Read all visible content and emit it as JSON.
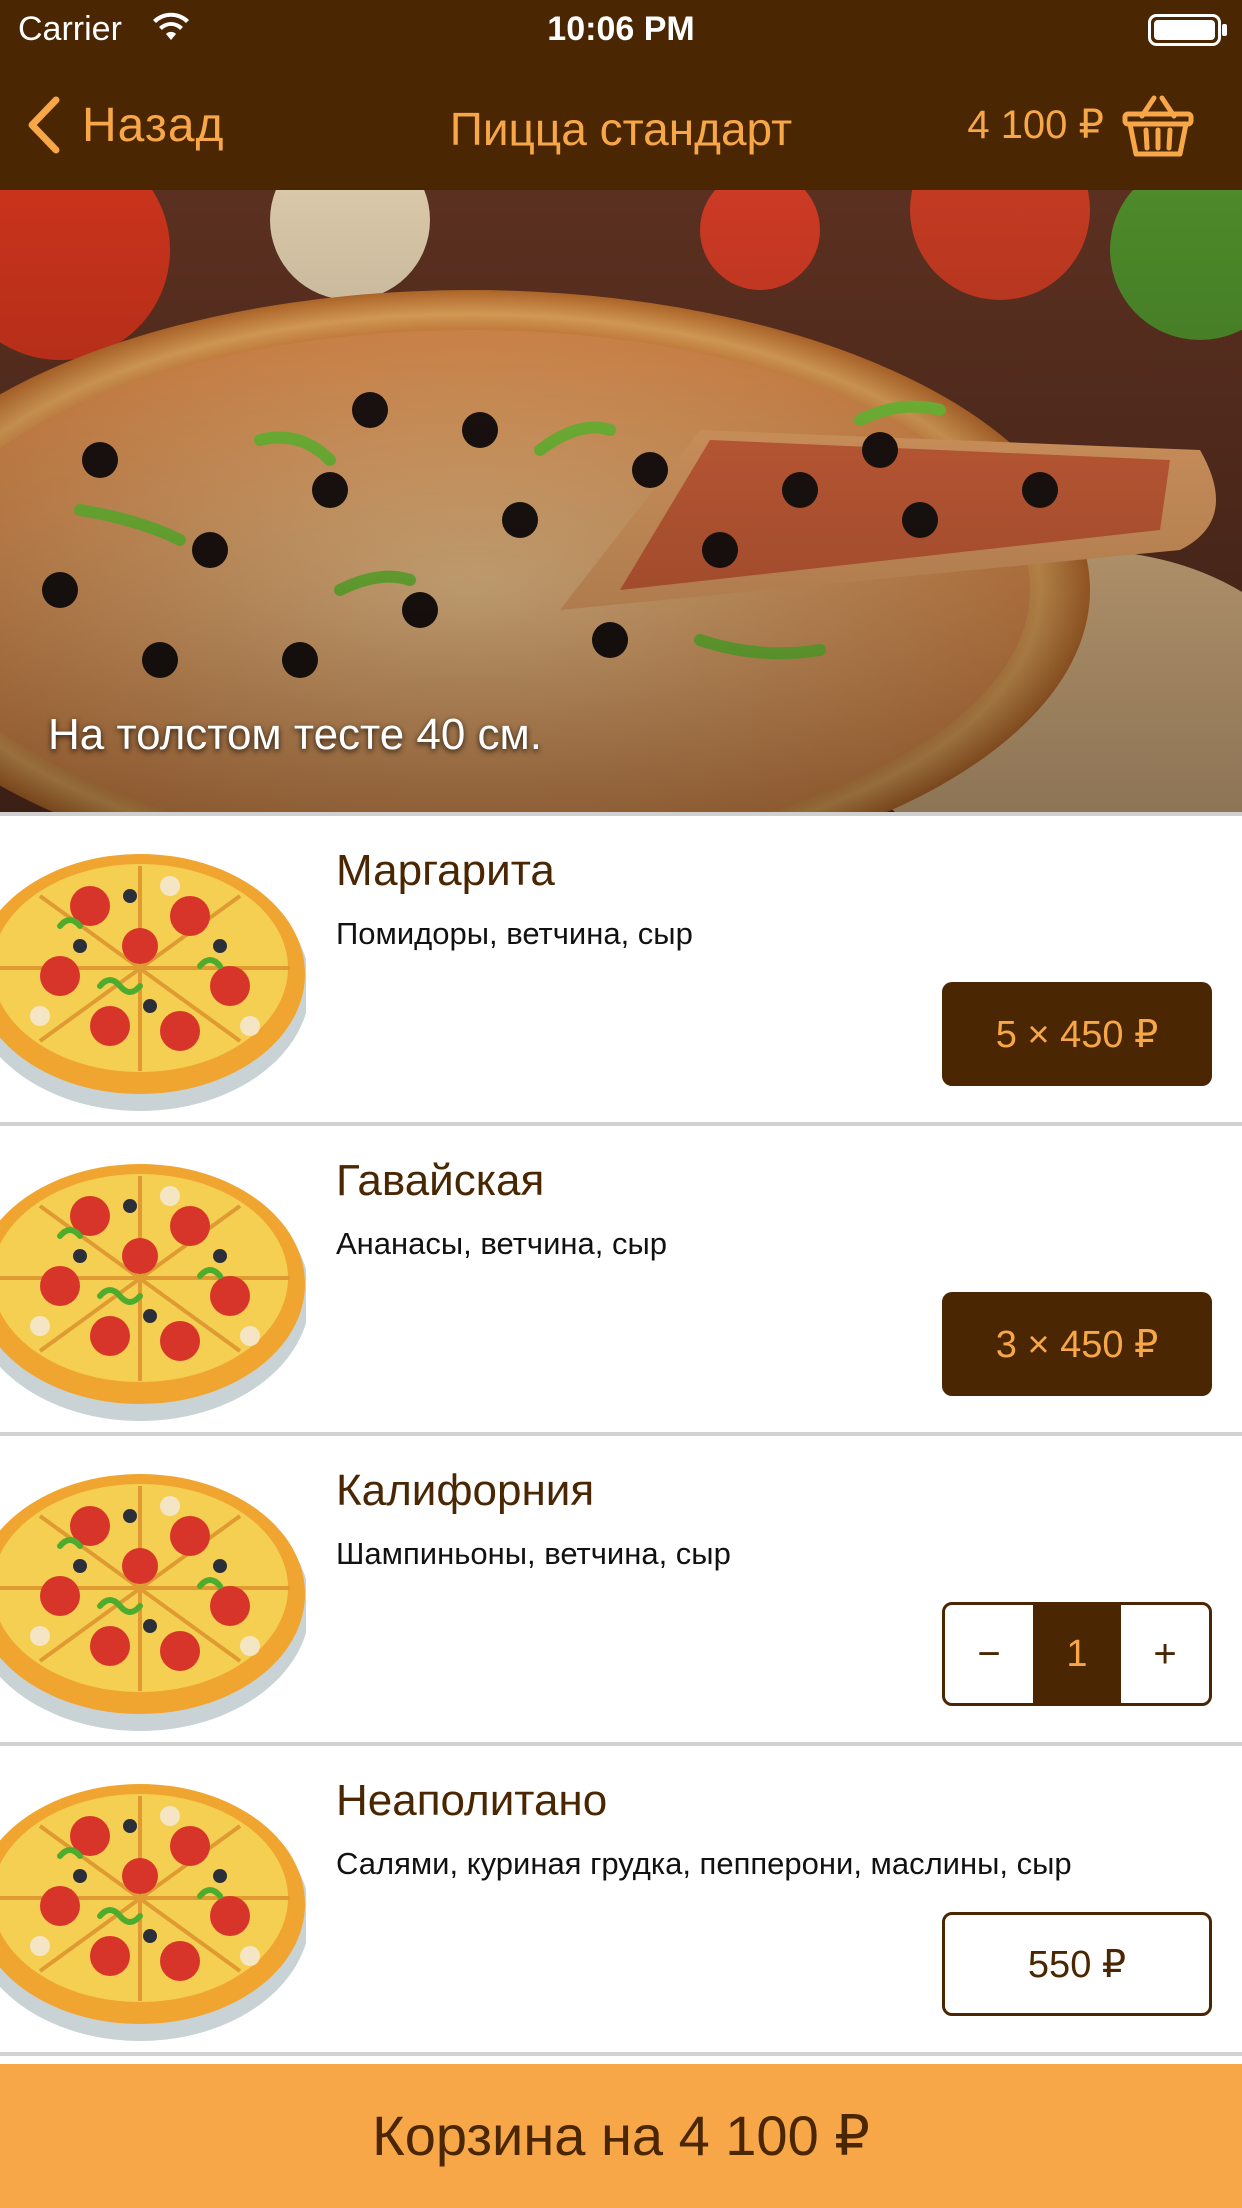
{
  "status_bar": {
    "carrier": "Carrier",
    "time": "10:06 PM"
  },
  "nav": {
    "back_label": "Назад",
    "title": "Пицца стандарт",
    "cart_total": "4 100 ₽"
  },
  "hero": {
    "caption": "На толстом тесте 40 см."
  },
  "items": [
    {
      "name": "Маргарита",
      "description": "Помидоры, ветчина, сыр",
      "price_label": "5 × 450 ₽"
    },
    {
      "name": "Гавайская",
      "description": "Ананасы, ветчина, сыр",
      "price_label": "3 × 450 ₽"
    },
    {
      "name": "Калифорния",
      "description": "Шампиньоны, ветчина, сыр",
      "stepper": {
        "minus": "−",
        "quantity": "1",
        "plus": "+"
      }
    },
    {
      "name": "Неаполитано",
      "description": "Салями, куриная грудка, пепперони, маслины, сыр",
      "price_label": "550 ₽"
    }
  ],
  "bottom_cart": {
    "label": "Корзина на 4 100 ₽"
  },
  "colors": {
    "brand_dark": "#4a2603",
    "accent": "#f7a747"
  }
}
